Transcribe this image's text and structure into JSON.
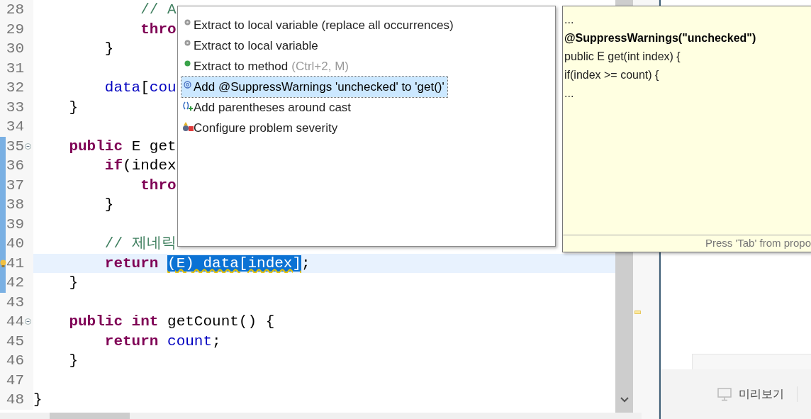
{
  "editor": {
    "lines": [
      {
        "number": "28",
        "current": false,
        "foldable": false,
        "warning": false,
        "segments": [
          {
            "kind": "comment",
            "text": "            // A"
          }
        ]
      },
      {
        "number": "29",
        "current": false,
        "foldable": false,
        "warning": false,
        "segments": [
          {
            "kind": "keyword",
            "text": "            thro"
          }
        ]
      },
      {
        "number": "30",
        "current": false,
        "foldable": false,
        "warning": false,
        "segments": [
          {
            "kind": "plain",
            "text": "        }"
          }
        ]
      },
      {
        "number": "31",
        "current": false,
        "foldable": false,
        "warning": false
      },
      {
        "number": "32",
        "current": false,
        "foldable": false,
        "warning": false,
        "segments": [
          {
            "kind": "field",
            "text": "        data"
          },
          {
            "kind": "plain",
            "text": "["
          },
          {
            "kind": "field",
            "text": "cou"
          }
        ]
      },
      {
        "number": "33",
        "current": false,
        "foldable": false,
        "warning": false,
        "segments": [
          {
            "kind": "plain",
            "text": "    }"
          }
        ]
      },
      {
        "number": "34",
        "current": false,
        "foldable": false,
        "warning": false
      },
      {
        "number": "35",
        "current": false,
        "foldable": true,
        "warning": false,
        "segments": [
          {
            "kind": "keyword",
            "text": "    public"
          },
          {
            "kind": "plain",
            "text": " E get"
          }
        ]
      },
      {
        "number": "36",
        "current": false,
        "foldable": false,
        "warning": false,
        "segments": [
          {
            "kind": "keyword",
            "text": "        if"
          },
          {
            "kind": "plain",
            "text": "(index"
          }
        ]
      },
      {
        "number": "37",
        "current": false,
        "foldable": false,
        "warning": false,
        "segments": [
          {
            "kind": "keyword",
            "text": "            thro"
          }
        ]
      },
      {
        "number": "38",
        "current": false,
        "foldable": false,
        "warning": false,
        "segments": [
          {
            "kind": "plain",
            "text": "        }"
          }
        ]
      },
      {
        "number": "39",
        "current": false,
        "foldable": false,
        "warning": false
      },
      {
        "number": "40",
        "current": false,
        "foldable": false,
        "warning": false,
        "segments": [
          {
            "kind": "comment",
            "text": "        // 제네릭"
          }
        ]
      },
      {
        "number": "41",
        "current": true,
        "foldable": false,
        "warning": true,
        "segments": [
          {
            "kind": "keyword",
            "text": "        return "
          },
          {
            "kind": "selection",
            "text": "(E) data[index]"
          },
          {
            "kind": "plain",
            "text": ";"
          }
        ]
      },
      {
        "number": "42",
        "current": false,
        "foldable": false,
        "warning": false,
        "segments": [
          {
            "kind": "plain",
            "text": "    }"
          }
        ]
      },
      {
        "number": "43",
        "current": false,
        "foldable": false,
        "warning": false
      },
      {
        "number": "44",
        "current": false,
        "foldable": true,
        "warning": false,
        "segments": [
          {
            "kind": "keyword",
            "text": "    public int"
          },
          {
            "kind": "plain",
            "text": " getCount() {"
          }
        ]
      },
      {
        "number": "45",
        "current": false,
        "foldable": false,
        "warning": false,
        "segments": [
          {
            "kind": "keyword",
            "text": "        return "
          },
          {
            "kind": "field",
            "text": "count"
          },
          {
            "kind": "plain",
            "text": ";"
          }
        ]
      },
      {
        "number": "46",
        "current": false,
        "foldable": false,
        "warning": false,
        "segments": [
          {
            "kind": "plain",
            "text": "    }"
          }
        ]
      },
      {
        "number": "47",
        "current": false,
        "foldable": false,
        "warning": false
      },
      {
        "number": "48",
        "current": false,
        "foldable": false,
        "warning": false,
        "segments": [
          {
            "kind": "plain",
            "text": "}"
          }
        ]
      }
    ]
  },
  "quick_fix": {
    "items": [
      {
        "kind": "local_variable",
        "label": "Extract to local variable (replace all occurrences)",
        "selected": false
      },
      {
        "kind": "local_variable",
        "label": "Extract to local variable",
        "selected": false
      },
      {
        "kind": "method",
        "label": "Extract to method",
        "shortcut": "(Ctrl+2, M)",
        "selected": false
      },
      {
        "kind": "annotation",
        "label": "Add @SuppressWarnings 'unchecked' to 'get()'",
        "selected": true
      },
      {
        "kind": "parentheses",
        "label": "Add parentheses around cast",
        "selected": false
      },
      {
        "kind": "configure",
        "label": "Configure problem severity",
        "selected": false
      }
    ]
  },
  "preview": {
    "lines": [
      {
        "text": "...",
        "bold": false
      },
      {
        "text": "@SuppressWarnings(\"unchecked\")",
        "bold": true
      },
      {
        "text": "public E get(int index) {",
        "bold": false
      },
      {
        "text": "if(index >= count) {",
        "bold": false
      },
      {
        "text": "...",
        "bold": false
      }
    ],
    "footer": "Press 'Tab' from propo"
  },
  "side_panel": {
    "preview_button": "미리보기"
  }
}
